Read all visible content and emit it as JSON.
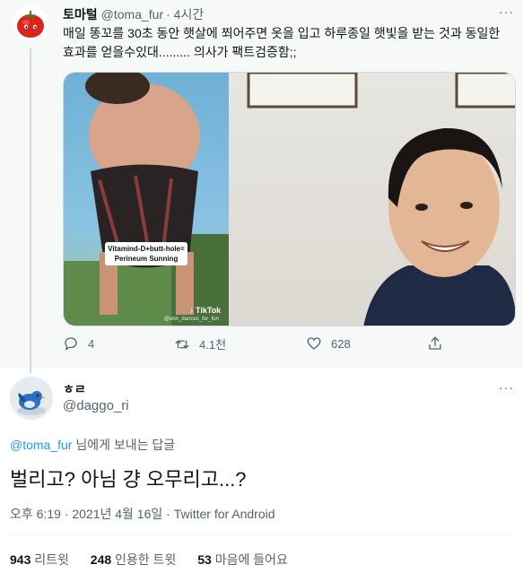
{
  "parent_tweet": {
    "display_name": "토마털",
    "handle": "@toma_fur",
    "time": "· 4시간",
    "text": "매일 똥꼬를 30초 동안 햇살에 쬐어주면 옷을 입고 하루종일 햇빛을 받는 것과 동일한 효과를 얻을수있대......... 의사가 팩트검증함;;",
    "more": "···",
    "media": {
      "caption_line1": "Vitamind-D+butt-hole=",
      "caption_line2": "Perineum Sunning",
      "watermark": "♪ TikTok",
      "watermark_user": "@erin_dances_for_fun"
    },
    "actions": {
      "reply_count": "4",
      "retweet_count": "4.1천",
      "like_count": "628"
    }
  },
  "reply_tweet": {
    "display_name": "ㅎㄹ",
    "handle": "@daggo_ri",
    "more": "···",
    "reply_to_handle": "@toma_fur",
    "reply_to_suffix": " 님에게 보내는 답글",
    "text": "벌리고? 아님 걍 오무리고...?",
    "meta": "오후 6:19 · 2021년 4월 16일 · Twitter for Android",
    "stats": {
      "retweets": "943",
      "retweets_label": "리트윗",
      "quotes": "248",
      "quotes_label": "인용한 트윗",
      "likes": "53",
      "likes_label": "마음에 들어요"
    }
  },
  "colors": {
    "link": "#1d9bf0",
    "secondary_text": "#536471",
    "primary_text": "#0f1419",
    "context_background": "#f7f9f9"
  },
  "icons": [
    "tomato-avatar",
    "reply-icon",
    "retweet-icon",
    "like-icon",
    "share-icon",
    "bird-avatar"
  ]
}
